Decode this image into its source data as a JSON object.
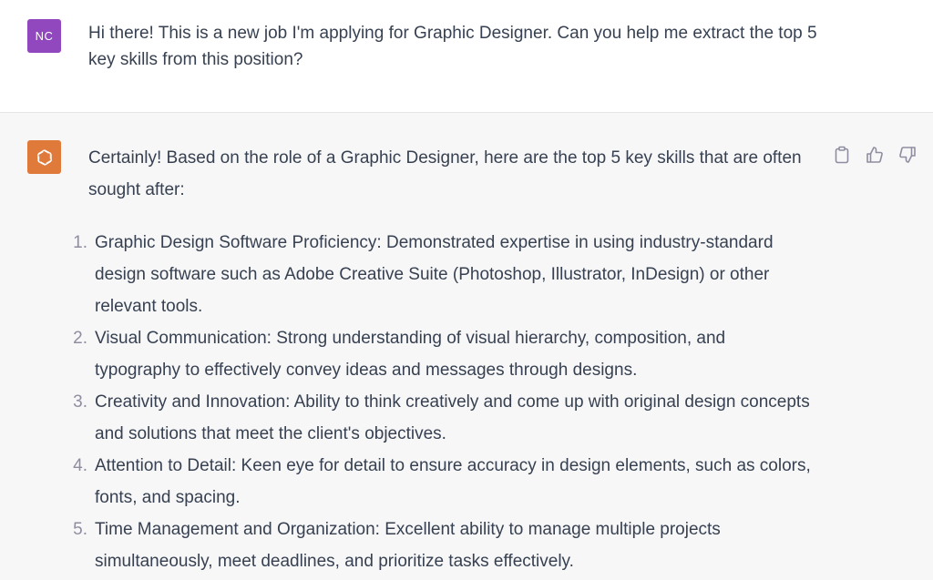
{
  "user_message": {
    "avatar_initials": "NC",
    "avatar_color": "#9147be",
    "text": "Hi there! This is a new job I'm applying for Graphic Designer. Can you help me extract the top 5 key skills from this position?"
  },
  "assistant_message": {
    "avatar_icon": "openai-logo-icon",
    "avatar_color": "#e07a3a",
    "intro": "Certainly! Based on the role of a Graphic Designer, here are the top 5 key skills that are often sought after:",
    "skills": [
      {
        "number": "1.",
        "text": "Graphic Design Software Proficiency: Demonstrated expertise in using industry-standard design software such as Adobe Creative Suite (Photoshop, Illustrator, InDesign) or other relevant tools."
      },
      {
        "number": "2.",
        "text": "Visual Communication: Strong understanding of visual hierarchy, composition, and typography to effectively convey ideas and messages through designs."
      },
      {
        "number": "3.",
        "text": "Creativity and Innovation: Ability to think creatively and come up with original design concepts and solutions that meet the client's objectives."
      },
      {
        "number": "4.",
        "text": "Attention to Detail: Keen eye for detail to ensure accuracy in design elements, such as colors, fonts, and spacing."
      },
      {
        "number": "5.",
        "text": "Time Management and Organization: Excellent ability to manage multiple projects simultaneously, meet deadlines, and prioritize tasks effectively."
      }
    ],
    "actions": [
      "clipboard-icon",
      "thumbs-up-icon",
      "thumbs-down-icon"
    ]
  }
}
